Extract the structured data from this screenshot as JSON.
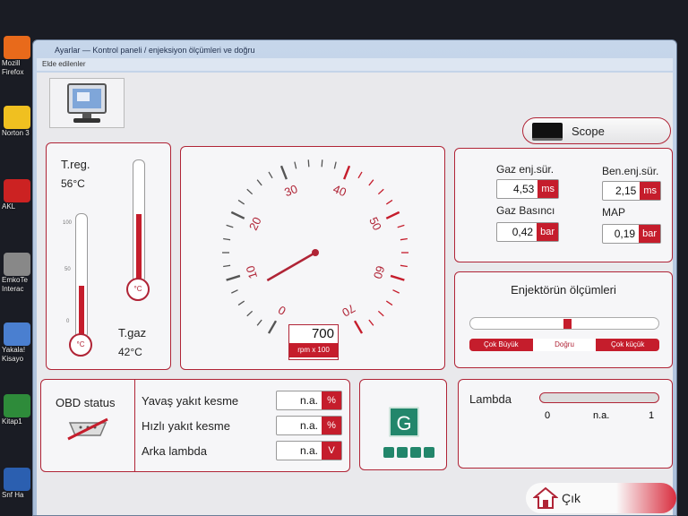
{
  "desktop": {
    "icons": [
      {
        "label": "Mozill Firefox",
        "color": "#e86a1b"
      },
      {
        "label": "Norton 3",
        "color": "#f0c020"
      },
      {
        "label": "AKL",
        "color": "#cc2222"
      },
      {
        "label": "EmkoTe Interac",
        "color": "#888888"
      },
      {
        "label": "Yakala! Kisayo",
        "color": "#4a7fd0"
      },
      {
        "label": "Kitap1",
        "color": "#2e8b3a"
      },
      {
        "label": "Snf Ha",
        "color": "#2b5fb0"
      }
    ]
  },
  "window": {
    "title": "Ayarlar — Kontrol paneli / enjeksiyon ölçümleri ve doğru",
    "menu": "Elde edilenler"
  },
  "temps": {
    "treg_label": "T.reg.",
    "treg_value": "56°C",
    "tgaz_label": "T.gaz",
    "tgaz_value": "42°C",
    "bulb_unit": "°C",
    "scale_top": "100",
    "scale_mid": "50",
    "scale_low": "0",
    "treg_level": 0.56,
    "tgaz_level": 0.42
  },
  "gauge": {
    "rpm_value": "700",
    "rpm_unit": "rpm x 100",
    "ticks": [
      "0",
      "10",
      "20",
      "30",
      "40",
      "50",
      "60",
      "70"
    ],
    "needle_value": 7
  },
  "sensors": {
    "gaz_enj_label": "Gaz enj.sür.",
    "gaz_enj_value": "4,53",
    "gaz_enj_unit": "ms",
    "ben_enj_label": "Ben.enj.sür.",
    "ben_enj_value": "2,15",
    "ben_enj_unit": "ms",
    "gaz_bas_label": "Gaz Basıncı",
    "gaz_bas_value": "0,42",
    "gaz_bas_unit": "bar",
    "map_label": "MAP",
    "map_value": "0,19",
    "map_unit": "bar"
  },
  "scope": {
    "label": "Scope"
  },
  "injector": {
    "title": "Enjektörün ölçümleri",
    "left": "Çok Büyük",
    "mid": "Doğru",
    "right": "Çok küçük",
    "position": 0.52
  },
  "obd": {
    "label": "OBD status",
    "rows": [
      {
        "label": "Yavaş yakıt kesme",
        "value": "n.a.",
        "unit": "%"
      },
      {
        "label": "Hızlı yakıt kesme",
        "value": "n.a.",
        "unit": "%"
      },
      {
        "label": "Arka lambda",
        "value": "n.a.",
        "unit": "V"
      }
    ]
  },
  "gas_status": {
    "letter": "G",
    "color": "#22866b"
  },
  "lambda": {
    "label": "Lambda",
    "min": "0",
    "value": "n.a.",
    "max": "1"
  },
  "exit": {
    "label": "Çık"
  },
  "colors": {
    "accent": "#c51d2c",
    "border": "#b02436"
  }
}
